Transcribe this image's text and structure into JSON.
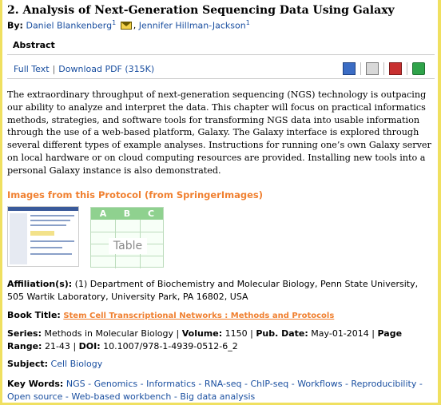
{
  "article": {
    "number_title": "2. Analysis of Next-Generation Sequencing Data Using Galaxy",
    "by_label": "By:",
    "authors": [
      {
        "name": "Daniel Blankenberg",
        "sup": "1"
      },
      {
        "name": "Jennifer Hillman-Jackson",
        "sup": "1"
      }
    ],
    "author_separator": ","
  },
  "abstract": {
    "heading": "Abstract",
    "text": "The extraordinary throughput of next-generation sequencing (NGS) technology is outpacing our ability to analyze and interpret the data. This chapter will focus on practical informatics methods, strategies, and software tools for transforming NGS data into usable information through the use of a web-based platform, Galaxy. The Galaxy interface is explored through several different types of example analyses. Instructions for running one’s own Galaxy server on local hardware or on cloud computing resources are provided. Installing new tools into a personal Galaxy instance is also demonstrated."
  },
  "toolbar": {
    "full_text": "Full Text",
    "separator": "|",
    "download_pdf": "Download PDF (315K)",
    "icons": [
      "reference-icon",
      "print-icon",
      "bookmark-icon",
      "share-icon"
    ]
  },
  "images": {
    "heading": "Images from this Protocol (from SpringerImages)",
    "table_cols": [
      "A",
      "B",
      "C"
    ],
    "table_label": "Table"
  },
  "meta": {
    "affiliation_label": "Affiliation(s):",
    "affiliation_value": "(1) Department of Biochemistry and Molecular Biology, Penn State University, 505 Wartik Laboratory, University Park, PA 16802, USA",
    "book_title_label": "Book Title:",
    "book_title_value": "Stem Cell Transcriptional Networks : Methods and Protocols",
    "series_label": "Series:",
    "series_value": "Methods in Molecular Biology",
    "volume_label": "Volume:",
    "volume_value": "1150",
    "pubdate_label": "Pub. Date:",
    "pubdate_value": "May-01-2014",
    "page_range_label": "Page Range:",
    "page_range_value": "21-43",
    "doi_label": "DOI:",
    "doi_value": "10.1007/978-1-4939-0512-6_2",
    "subject_label": "Subject:",
    "subject_value": "Cell Biology",
    "keywords_label": "Key Words:",
    "keywords": [
      "NGS",
      "Genomics",
      "Informatics",
      "RNA-seq",
      "ChIP-seq",
      "Workflows",
      "Reproducibility",
      "Open source",
      "Web-based workbench",
      "Big data analysis"
    ],
    "pipe": "|",
    "dash": "-"
  },
  "colors": {
    "frame_border": "#f0e060",
    "link_blue": "#1a4fa0",
    "accent_orange": "#f08030"
  }
}
